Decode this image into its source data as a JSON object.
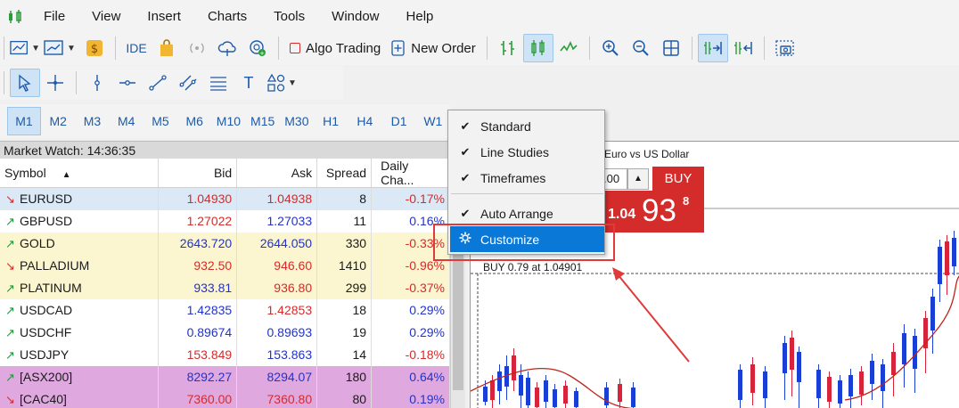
{
  "menu": [
    "File",
    "View",
    "Insert",
    "Charts",
    "Tools",
    "Window",
    "Help"
  ],
  "toolbar": {
    "ide_label": "IDE",
    "algo_trading_label": "Algo Trading",
    "new_order_label": "New Order"
  },
  "timeframes": [
    "M1",
    "M2",
    "M3",
    "M4",
    "M5",
    "M6",
    "M10",
    "M15",
    "M30",
    "H1",
    "H4",
    "D1",
    "W1"
  ],
  "market_watch": {
    "title": "Market Watch: 14:36:35",
    "columns": [
      "Symbol",
      "Bid",
      "Ask",
      "Spread",
      "Daily Cha..."
    ],
    "rows": [
      {
        "symbol": "EURUSD",
        "dir": "down",
        "bid": "1.04930",
        "ask": "1.04938",
        "spread": "8",
        "change": "-0.17%",
        "bid_color": "red",
        "ask_color": "red",
        "bg": "#dbe9f7"
      },
      {
        "symbol": "GBPUSD",
        "dir": "up",
        "bid": "1.27022",
        "ask": "1.27033",
        "spread": "11",
        "change": "0.16%",
        "bid_color": "red",
        "ask_color": "blue",
        "bg": "#ffffff"
      },
      {
        "symbol": "GOLD",
        "dir": "up",
        "bid": "2643.720",
        "ask": "2644.050",
        "spread": "330",
        "change": "-0.33%",
        "bid_color": "blue",
        "ask_color": "blue",
        "bg": "#fbf6cf"
      },
      {
        "symbol": "PALLADIUM",
        "dir": "down",
        "bid": "932.50",
        "ask": "946.60",
        "spread": "1410",
        "change": "-0.96%",
        "bid_color": "red",
        "ask_color": "red",
        "bg": "#fbf6cf"
      },
      {
        "symbol": "PLATINUM",
        "dir": "up",
        "bid": "933.81",
        "ask": "936.80",
        "spread": "299",
        "change": "-0.37%",
        "bid_color": "blue",
        "ask_color": "red",
        "bg": "#fbf6cf"
      },
      {
        "symbol": "USDCAD",
        "dir": "up",
        "bid": "1.42835",
        "ask": "1.42853",
        "spread": "18",
        "change": "0.29%",
        "bid_color": "blue",
        "ask_color": "red",
        "bg": "#ffffff"
      },
      {
        "symbol": "USDCHF",
        "dir": "up",
        "bid": "0.89674",
        "ask": "0.89693",
        "spread": "19",
        "change": "0.29%",
        "bid_color": "blue",
        "ask_color": "blue",
        "bg": "#ffffff"
      },
      {
        "symbol": "USDJPY",
        "dir": "up",
        "bid": "153.849",
        "ask": "153.863",
        "spread": "14",
        "change": "-0.18%",
        "bid_color": "red",
        "ask_color": "blue",
        "bg": "#ffffff"
      },
      {
        "symbol": "[ASX200]",
        "dir": "up",
        "bid": "8292.27",
        "ask": "8294.07",
        "spread": "180",
        "change": "0.64%",
        "bid_color": "blue",
        "ask_color": "blue",
        "bg": "#dfa9df"
      },
      {
        "symbol": "[CAC40]",
        "dir": "down",
        "bid": "7360.00",
        "ask": "7360.80",
        "spread": "80",
        "change": "0.19%",
        "bid_color": "red",
        "ask_color": "red",
        "bg": "#dfa9df"
      }
    ]
  },
  "chart": {
    "title": "Euro vs US Dollar",
    "lot_value": ".00",
    "buy_label": "BUY",
    "price_small": "1.04",
    "price_big": "93",
    "price_sup": "8",
    "trade_line_label": "BUY 0.79 at 1.04901"
  },
  "context_menu": [
    {
      "label": "Standard",
      "checked": true
    },
    {
      "label": "Line Studies",
      "checked": true
    },
    {
      "label": "Timeframes",
      "checked": true
    },
    {
      "label": "Auto Arrange",
      "checked": true
    },
    {
      "label": "Customize",
      "checked": false,
      "icon": "gear-icon"
    }
  ],
  "colors": {
    "accent": "#0a78d7",
    "buy_red": "#d42b2b",
    "bull": "#1a3fd6",
    "bear": "#d8243b"
  }
}
